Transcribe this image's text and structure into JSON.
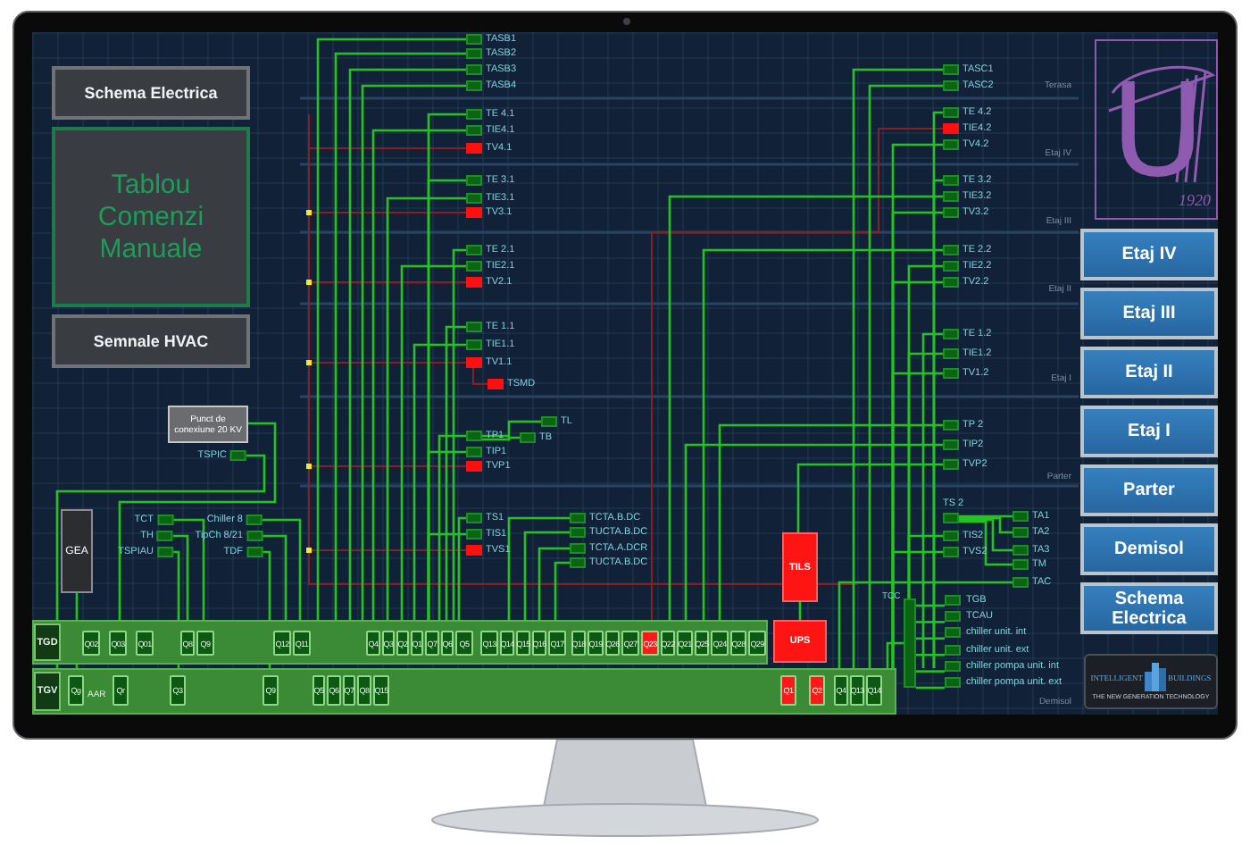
{
  "left_menu": [
    {
      "label": "Schema Electrica",
      "selected": false
    },
    {
      "label": "Tablou Comenzi Manuale",
      "selected": true
    },
    {
      "label": "Semnale HVAC",
      "selected": false
    }
  ],
  "tags": [
    {
      "label": "TASB1",
      "alarm": false
    },
    {
      "label": "TASB2",
      "alarm": false
    },
    {
      "label": "TASB3",
      "alarm": false
    },
    {
      "label": "TASB4",
      "alarm": false
    },
    {
      "label": "TE 4.1",
      "alarm": false
    },
    {
      "label": "TIE4.1",
      "alarm": false
    },
    {
      "label": "TV4.1",
      "alarm": true
    },
    {
      "label": "TE 3.1",
      "alarm": false
    },
    {
      "label": "TIE3.1",
      "alarm": false
    },
    {
      "label": "TV3.1",
      "alarm": true
    },
    {
      "label": "TE 2.1",
      "alarm": false
    },
    {
      "label": "TIE2.1",
      "alarm": false
    },
    {
      "label": "TV2.1",
      "alarm": true
    },
    {
      "label": "TE 1.1",
      "alarm": false
    },
    {
      "label": "TIE1.1",
      "alarm": false
    },
    {
      "label": "TV1.1",
      "alarm": true
    },
    {
      "label": "TSMD",
      "alarm": true
    },
    {
      "label": "TL",
      "alarm": false
    },
    {
      "label": "TP1",
      "alarm": false
    },
    {
      "label": "TB",
      "alarm": false
    },
    {
      "label": "TIP1",
      "alarm": false
    },
    {
      "label": "TVP1",
      "alarm": true
    },
    {
      "label": "TS1",
      "alarm": false
    },
    {
      "label": "TIS1",
      "alarm": false
    },
    {
      "label": "TVS1",
      "alarm": true
    },
    {
      "label": "TCTA.B.DC",
      "alarm": false
    },
    {
      "label": "TUCTA.B.DC",
      "alarm": false
    },
    {
      "label": "TCTA.A.DCR",
      "alarm": false
    },
    {
      "label": "TUCTA.B.DC",
      "alarm": false
    },
    {
      "label": "TASC1",
      "alarm": false
    },
    {
      "label": "TASC2",
      "alarm": false
    },
    {
      "label": "TE 4.2",
      "alarm": false
    },
    {
      "label": "TIE4.2",
      "alarm": true
    },
    {
      "label": "TV4.2",
      "alarm": false
    },
    {
      "label": "TE 3.2",
      "alarm": false
    },
    {
      "label": "TIE3.2",
      "alarm": false
    },
    {
      "label": "TV3.2",
      "alarm": false
    },
    {
      "label": "TE 2.2",
      "alarm": false
    },
    {
      "label": "TIE2.2",
      "alarm": false
    },
    {
      "label": "TV2.2",
      "alarm": false
    },
    {
      "label": "TE 1.2",
      "alarm": false
    },
    {
      "label": "TIE1.2",
      "alarm": false
    },
    {
      "label": "TV1.2",
      "alarm": false
    },
    {
      "label": "TP 2",
      "alarm": false
    },
    {
      "label": "TIP2",
      "alarm": false
    },
    {
      "label": "TVP2",
      "alarm": false
    },
    {
      "label": "TS 2",
      "alarm": false
    },
    {
      "label": "TIS2",
      "alarm": false
    },
    {
      "label": "TVS2",
      "alarm": false
    },
    {
      "label": "TA1",
      "alarm": false
    },
    {
      "label": "TA2",
      "alarm": false
    },
    {
      "label": "TA3",
      "alarm": false
    },
    {
      "label": "TM",
      "alarm": false
    },
    {
      "label": "TAC",
      "alarm": false
    },
    {
      "label": "TSPIC",
      "alarm": false
    },
    {
      "label": "TCT",
      "alarm": false
    },
    {
      "label": "TH",
      "alarm": false
    },
    {
      "label": "TSPIAU",
      "alarm": false
    },
    {
      "label": "Chiller 8",
      "alarm": false
    },
    {
      "label": "TipCh 8/21",
      "alarm": false
    },
    {
      "label": "TDF",
      "alarm": false
    }
  ],
  "equipment": [
    {
      "label": "Punct de conexiune 20 KV",
      "alarm": false
    },
    {
      "label": "GEA",
      "alarm": false
    },
    {
      "label": "TILS",
      "alarm": true
    },
    {
      "label": "UPS",
      "alarm": true
    }
  ],
  "buses": [
    {
      "label": "TGD",
      "breakers": [
        {
          "label": "Q02",
          "alarm": false
        },
        {
          "label": "Q03",
          "alarm": false
        },
        {
          "label": "Q01",
          "alarm": false
        },
        {
          "label": "Q8",
          "alarm": false
        },
        {
          "label": "Q9",
          "alarm": false
        },
        {
          "label": "Q12",
          "alarm": false
        },
        {
          "label": "Q11",
          "alarm": false
        },
        {
          "label": "Q4",
          "alarm": false
        },
        {
          "label": "Q3",
          "alarm": false
        },
        {
          "label": "Q2",
          "alarm": false
        },
        {
          "label": "Q1",
          "alarm": false
        },
        {
          "label": "Q7",
          "alarm": false
        },
        {
          "label": "Q6",
          "alarm": false
        },
        {
          "label": "Q5",
          "alarm": false
        },
        {
          "label": "Q13",
          "alarm": false
        },
        {
          "label": "Q14",
          "alarm": false
        },
        {
          "label": "Q15",
          "alarm": false
        },
        {
          "label": "Q16",
          "alarm": false
        },
        {
          "label": "Q17",
          "alarm": false
        },
        {
          "label": "Q18",
          "alarm": false
        },
        {
          "label": "Q19",
          "alarm": false
        },
        {
          "label": "Q26",
          "alarm": false
        },
        {
          "label": "Q27",
          "alarm": false
        },
        {
          "label": "Q23",
          "alarm": true
        },
        {
          "label": "Q22",
          "alarm": false
        },
        {
          "label": "Q21",
          "alarm": false
        },
        {
          "label": "Q25",
          "alarm": false
        },
        {
          "label": "Q24",
          "alarm": false
        },
        {
          "label": "Q28",
          "alarm": false
        },
        {
          "label": "Q29",
          "alarm": false
        }
      ]
    },
    {
      "label": "TGV",
      "note": "AAR",
      "breakers": [
        {
          "label": "Qg",
          "alarm": false
        },
        {
          "label": "Qr",
          "alarm": false
        },
        {
          "label": "Q3",
          "alarm": false
        },
        {
          "label": "Q9",
          "alarm": false
        },
        {
          "label": "Q5",
          "alarm": false
        },
        {
          "label": "Q6",
          "alarm": false
        },
        {
          "label": "Q7",
          "alarm": false
        },
        {
          "label": "Q8",
          "alarm": false
        },
        {
          "label": "Q15",
          "alarm": false
        },
        {
          "label": "Q1",
          "alarm": true
        },
        {
          "label": "Q2",
          "alarm": true
        },
        {
          "label": "Q4",
          "alarm": false
        },
        {
          "label": "Q13",
          "alarm": false
        },
        {
          "label": "Q14",
          "alarm": false
        }
      ]
    }
  ],
  "tcc": {
    "label": "TCC",
    "outputs": [
      "TGB",
      "TCAU",
      "chiller unit. int",
      "chiller unit. ext",
      "chiller pompa unit. int",
      "chiller pompa unit. ext"
    ]
  },
  "floors": [
    "Terasa",
    "Etaj IV",
    "Etaj III",
    "Etaj II",
    "Etaj I",
    "Parter",
    "Demisol"
  ],
  "logo": {
    "letter": "U",
    "year": "1920"
  },
  "nav": [
    "Etaj IV",
    "Etaj III",
    "Etaj II",
    "Etaj I",
    "Parter",
    "Demisol",
    "Schema Electrica"
  ],
  "brand": {
    "left": "INTELLIGENT",
    "right": "BUILDINGS",
    "tagline": "THE NEW GENERATION TECHNOLOGY"
  }
}
